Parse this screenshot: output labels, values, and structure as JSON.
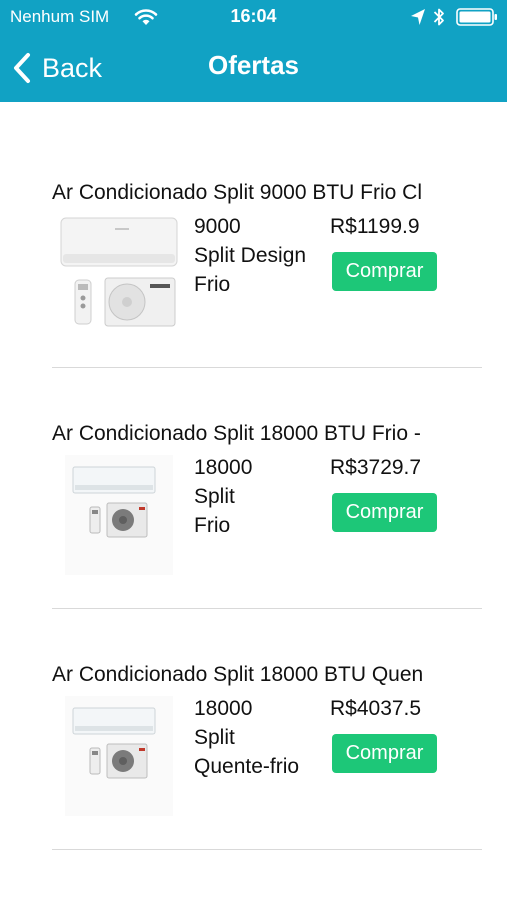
{
  "status_bar": {
    "carrier": "Nenhum SIM",
    "time": "16:04",
    "icons": [
      "wifi-icon",
      "location-icon",
      "bluetooth-icon",
      "battery-icon"
    ]
  },
  "nav": {
    "back_label": "Back",
    "title": "Ofertas"
  },
  "colors": {
    "header_bg": "#11a2c4",
    "buy_button_bg": "#1dc778",
    "divider": "#d9d9d9"
  },
  "offers": [
    {
      "title": "Ar Condicionado Split 9000 BTU Frio Cl",
      "btu": "9000",
      "type": "Split Design",
      "mode": "Frio",
      "price": "R$1199.9",
      "buy_label": "Comprar",
      "image_icon": "air-conditioner-design-image"
    },
    {
      "title": "Ar Condicionado Split 18000 BTU Frio -",
      "btu": "18000",
      "type": "Split",
      "mode": "Frio",
      "price": "R$3729.7",
      "buy_label": "Comprar",
      "image_icon": "air-conditioner-image"
    },
    {
      "title": "Ar Condicionado Split 18000 BTU Quen",
      "btu": "18000",
      "type": "Split",
      "mode": "Quente-frio",
      "price": "R$4037.5",
      "buy_label": "Comprar",
      "image_icon": "air-conditioner-image"
    }
  ]
}
